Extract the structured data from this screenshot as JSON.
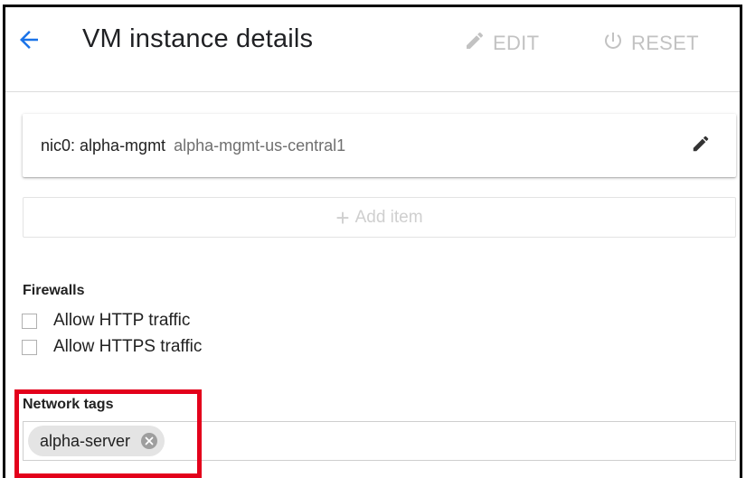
{
  "header": {
    "title": "VM instance details",
    "edit_label": "EDIT",
    "reset_label": "RESET",
    "icons": {
      "back": "arrow-back-icon",
      "edit": "pencil-icon",
      "reset": "power-icon"
    },
    "colors": {
      "back_arrow": "#1a73e8",
      "disabled_action": "#c2c2c2"
    }
  },
  "network_interface": {
    "name": "nic0: alpha-mgmt",
    "subnet": "alpha-mgmt-us-central1",
    "edit_icon": "pencil-icon"
  },
  "add_item": {
    "label": "Add item",
    "icon": "plus-icon"
  },
  "firewalls": {
    "label": "Firewalls",
    "options": [
      {
        "label": "Allow HTTP traffic",
        "checked": false
      },
      {
        "label": "Allow HTTPS traffic",
        "checked": false
      }
    ]
  },
  "network_tags": {
    "label": "Network tags",
    "tags": [
      "alpha-server"
    ],
    "chip_close_icon": "close-circle-icon"
  },
  "annotation": {
    "highlight_color": "#e3001b"
  }
}
